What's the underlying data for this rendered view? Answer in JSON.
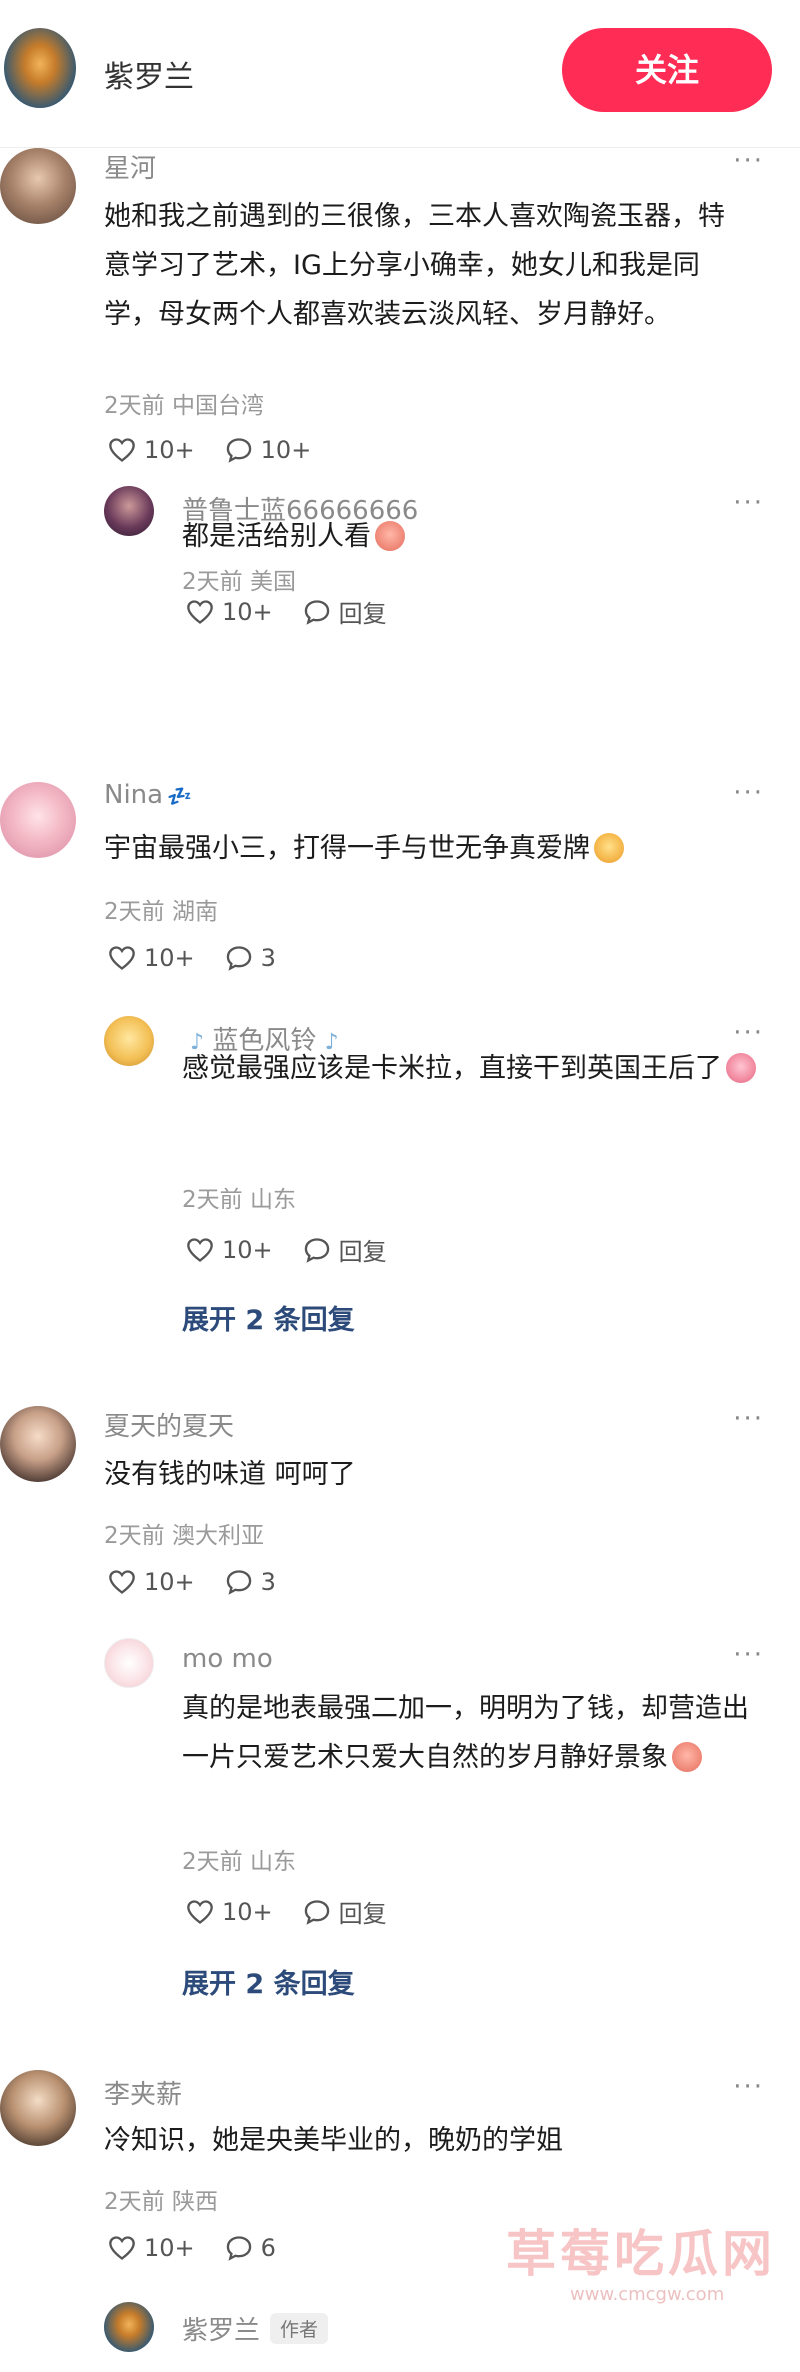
{
  "header": {
    "name": "紫罗兰",
    "follow_label": "关注"
  },
  "more_label": "···",
  "comments": [
    {
      "name": "星河",
      "text": "她和我之前遇到的三很像，三本人喜欢陶瓷玉器，特意学习了艺术，IG上分享小确幸，她女儿和我是同学，母女两个人都喜欢装云淡风轻、岁月静好。",
      "time": "2天前",
      "location": "中国台湾",
      "likes": "10+",
      "replies": "10+",
      "sub": {
        "name": "普鲁士蓝66666666",
        "text": "都是活给别人看",
        "time": "2天前",
        "location": "美国",
        "likes": "10+",
        "reply_label": "回复"
      }
    },
    {
      "name": "Nina",
      "text": "宇宙最强小三，打得一手与世无争真爱牌",
      "time": "2天前",
      "location": "湖南",
      "likes": "10+",
      "replies": "3",
      "sub": {
        "name": "蓝色风铃",
        "text": "感觉最强应该是卡米拉，直接干到英国王后了",
        "time": "2天前",
        "location": "山东",
        "likes": "10+",
        "reply_label": "回复"
      },
      "expand": "展开 2 条回复"
    },
    {
      "name": "夏天的夏天",
      "text": "没有钱的味道 呵呵了",
      "time": "2天前",
      "location": "澳大利亚",
      "likes": "10+",
      "replies": "3",
      "sub": {
        "name": "mo mo",
        "text": "真的是地表最强二加一，明明为了钱，却营造出一片只爱艺术只爱大自然的岁月静好景象",
        "time": "2天前",
        "location": "山东",
        "likes": "10+",
        "reply_label": "回复"
      },
      "expand": "展开 2 条回复"
    },
    {
      "name": "李夹薪",
      "text": "冷知识，她是央美毕业的，晚奶的学姐",
      "time": "2天前",
      "location": "陕西",
      "likes": "10+",
      "replies": "6",
      "sub": {
        "name": "紫罗兰",
        "author_tag": "作者"
      }
    }
  ],
  "watermark": {
    "title": "草莓吃瓜网",
    "url": "www.cmcgw.com"
  },
  "colors": {
    "accent": "#ff2c55",
    "link": "#2c4a7a",
    "meta": "#9a9a9a"
  }
}
